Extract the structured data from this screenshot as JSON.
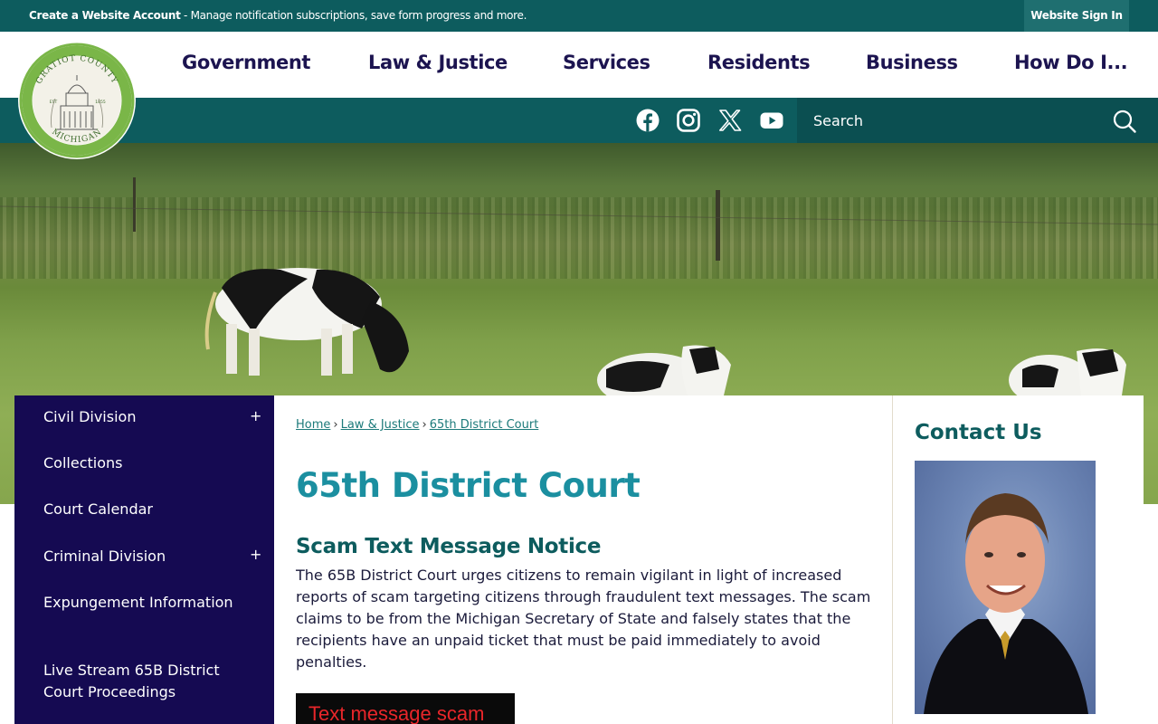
{
  "topbar": {
    "create_account_label": "Create a Website Account",
    "message": " - Manage notification subscriptions, save form progress and more.",
    "signin_label": "Website Sign In"
  },
  "logo": {
    "top_text": "GRATIOT COUNTY",
    "bottom_text": "MICHIGAN",
    "left_text": "EST",
    "right_text": "1855"
  },
  "nav": {
    "items": [
      {
        "label": "Government"
      },
      {
        "label": "Law & Justice"
      },
      {
        "label": "Services"
      },
      {
        "label": "Residents"
      },
      {
        "label": "Business"
      },
      {
        "label": "How Do I..."
      }
    ]
  },
  "social": {
    "icons": [
      "facebook-icon",
      "instagram-icon",
      "x-icon",
      "youtube-icon"
    ]
  },
  "search": {
    "placeholder": "Search"
  },
  "sidenav": {
    "items": [
      {
        "label": "Civil Division",
        "expandable": true
      },
      {
        "label": "Collections",
        "expandable": false
      },
      {
        "label": "Court Calendar",
        "expandable": false
      },
      {
        "label": "Criminal Division",
        "expandable": true
      },
      {
        "label": "Expungement Information",
        "expandable": false
      },
      {
        "label": "Live Stream 65B District Court Proceedings",
        "expandable": false
      }
    ],
    "expand_symbol": "+"
  },
  "breadcrumb": {
    "items": [
      "Home",
      "Law & Justice",
      "65th District Court"
    ],
    "separator": "›"
  },
  "main": {
    "page_title": "65th District Court",
    "notice_title": "Scam Text Message Notice",
    "notice_body": "The 65B District Court urges citizens to remain vigilant in light of increased reports of scam targeting citizens through fraudulent text messages. The scam claims to be from the Michigan Secretary of State and falsely states that the recipients have an unpaid ticket that must be paid immediately to avoid penalties.",
    "image_caption": "Text message scam"
  },
  "contact": {
    "title": "Contact Us"
  },
  "colors": {
    "teal": "#0d5c5e",
    "navy": "#150a52",
    "title_teal": "#1b8fa0",
    "nav_text": "#1c1450"
  }
}
